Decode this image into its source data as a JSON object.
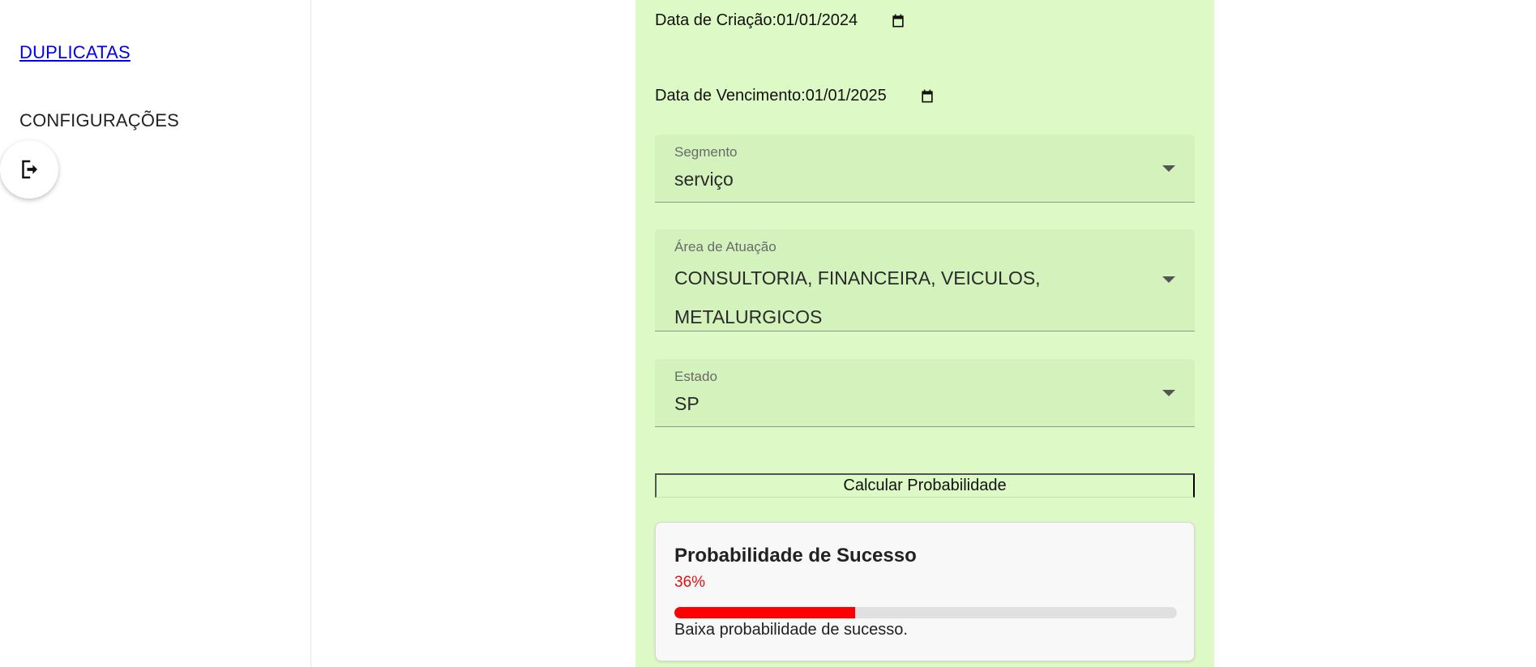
{
  "sidebar": {
    "items": [
      {
        "label": "DUPLICATAS"
      },
      {
        "label": "CONFIGURAÇÕES"
      }
    ],
    "logout_icon": "logout-icon"
  },
  "form": {
    "creation_date": {
      "label": "Data de Criação:",
      "value": "01/01/2024"
    },
    "due_date": {
      "label": "Data de Vencimento:",
      "value": "01/01/2025"
    },
    "segment": {
      "label": "Segmento",
      "value": "serviço"
    },
    "area": {
      "label": "Área de Atuação",
      "value": "CONSULTORIA, FINANCEIRA, VEICULOS, METALURGICOS"
    },
    "state": {
      "label": "Estado",
      "value": "SP"
    },
    "calc_label": "Calcular Probabilidade"
  },
  "result": {
    "title": "Probabilidade de Sucesso",
    "percent_text": "36%",
    "percent_value": 0.36,
    "message": "Baixa probabilidade de sucesso.",
    "bar_color": "#ff0000",
    "percent_color": "#e01010"
  },
  "colors": {
    "panel_bg": "#ddf9c5",
    "select_bg": "#d3f2bc"
  }
}
